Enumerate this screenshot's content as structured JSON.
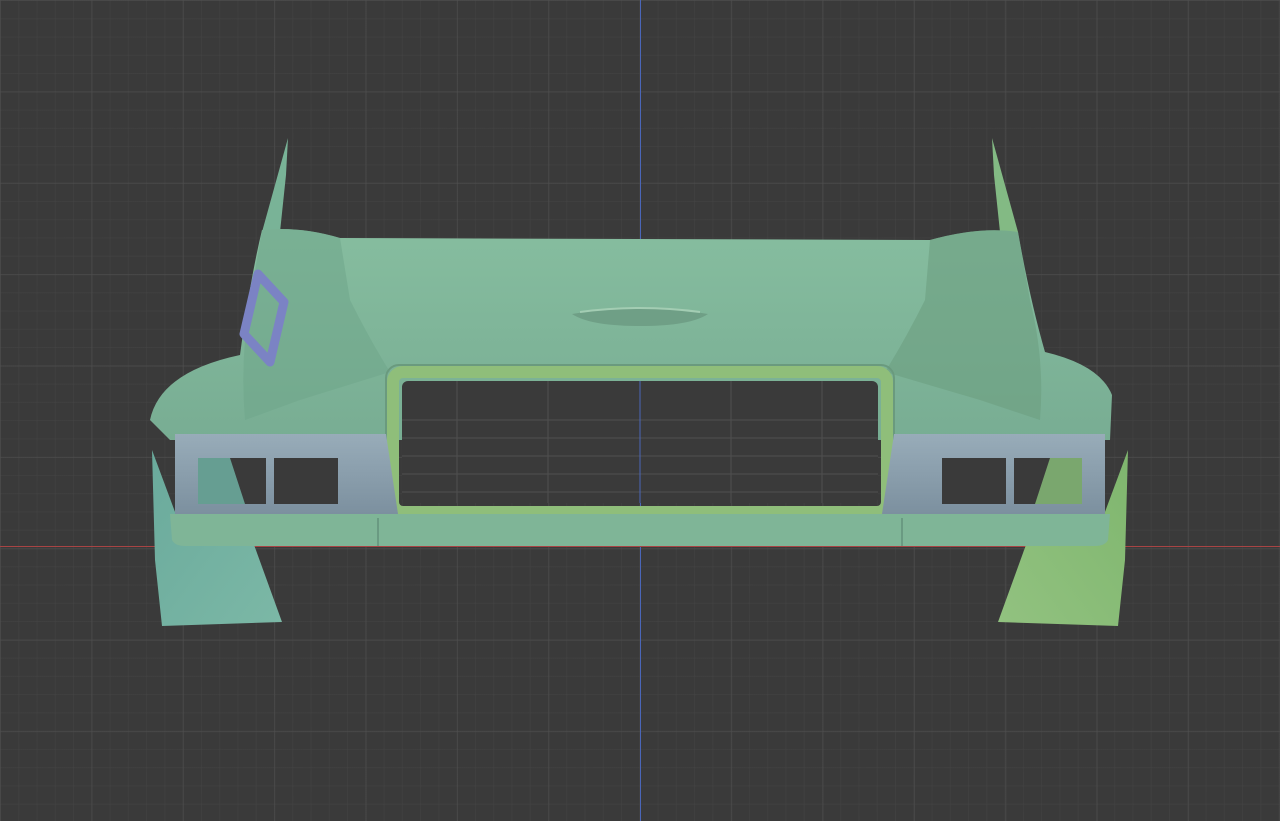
{
  "viewport": {
    "background_color": "#3a3a3a",
    "grid_color": "#505050",
    "axis_x_color": "#a84444",
    "axis_z_color": "#4a66b8"
  },
  "model": {
    "body_color": "#7fb59b",
    "body_shadow_color": "#5f9a80",
    "bumper_color": "#8a9fae",
    "grille_color": "#8fbe7a",
    "emblem_color": "#7b83c4",
    "left_fender_color": "#6fb0a2",
    "right_fender_color": "#86bb78"
  }
}
